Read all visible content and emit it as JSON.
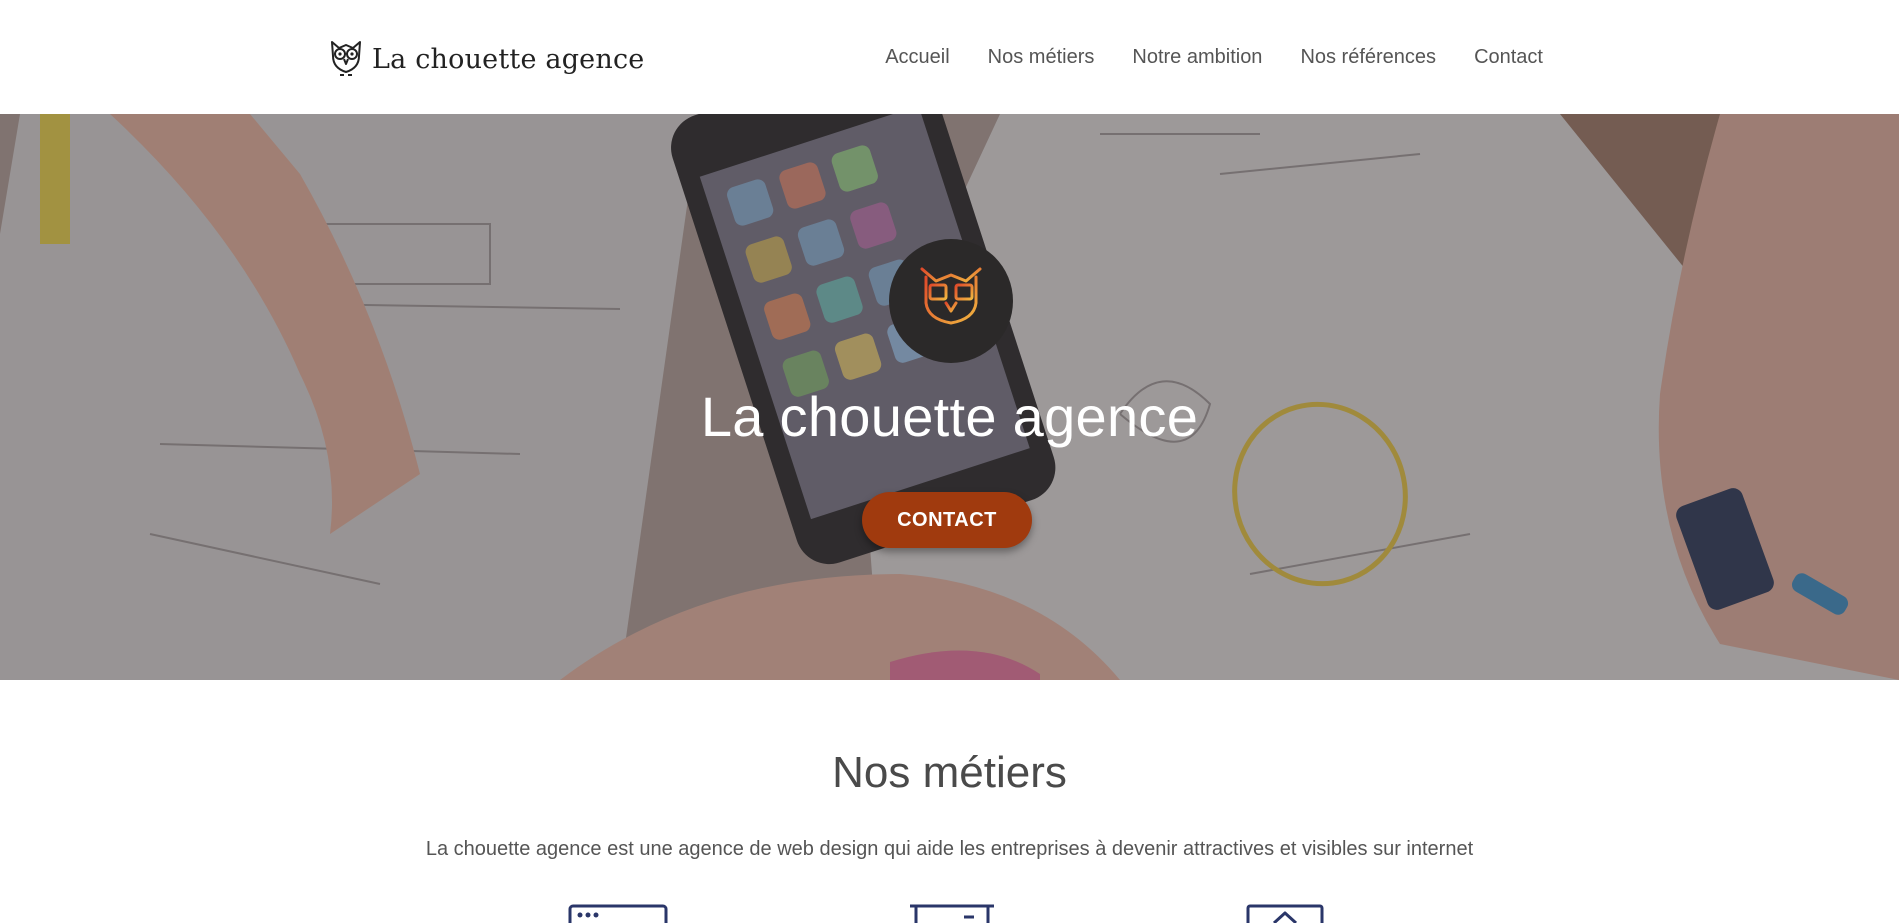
{
  "header": {
    "logo_text": "La chouette agence",
    "nav": [
      "Accueil",
      "Nos métiers",
      "Notre ambition",
      "Nos références",
      "Contact"
    ]
  },
  "hero": {
    "title": "La chouette agence",
    "button_label": "CONTACT"
  },
  "metiers": {
    "title": "Nos métiers",
    "subtitle": "La chouette agence est une agence de web design qui aide les entreprises à devenir attractives et visibles sur internet"
  },
  "colors": {
    "accent": "#a03a0e",
    "emblem_bg": "#2b2929",
    "icon_navy": "#2a3669"
  },
  "icons": [
    "owl-logo-icon",
    "owl-emblem-icon",
    "browser-icon",
    "presentation-icon",
    "house-icon"
  ]
}
